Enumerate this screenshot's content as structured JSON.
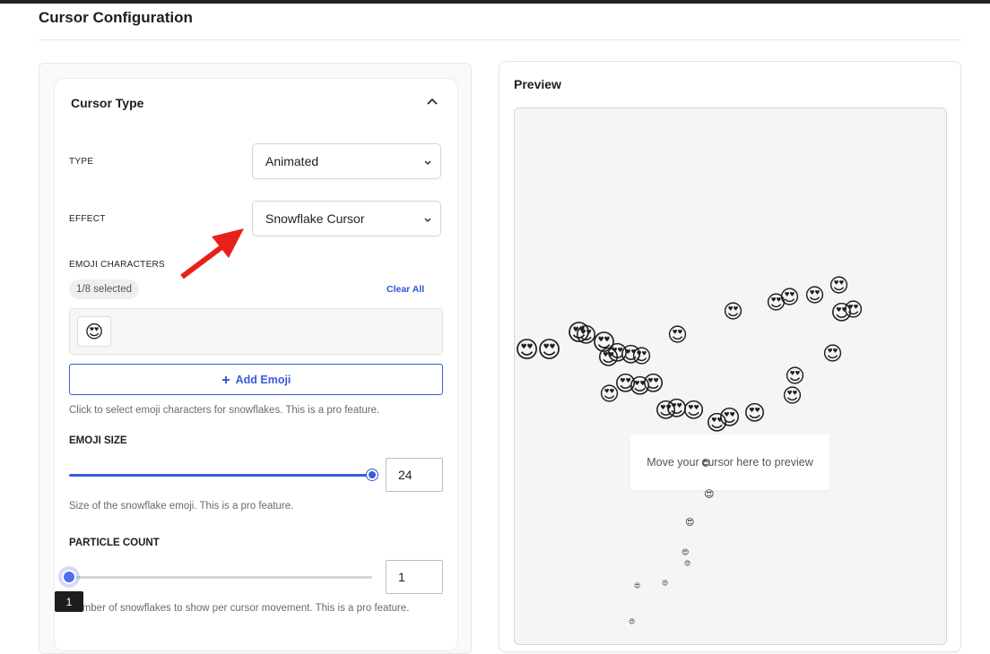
{
  "page": {
    "title": "Cursor Configuration"
  },
  "cursor_type": {
    "title": "Cursor Type",
    "type_label": "TYPE",
    "type_value": "Animated",
    "effect_label": "EFFECT",
    "effect_value": "Snowflake Cursor",
    "emoji_label": "EMOJI CHARACTERS",
    "selected_badge": "1/8 selected",
    "clear_all": "Clear All",
    "selected_emoji": "😍",
    "add_emoji_label": "Add Emoji",
    "add_emoji_help": "Click to select emoji characters for snowflakes. This is a pro feature.",
    "emoji_size_label": "EMOJI SIZE",
    "emoji_size_value": "24",
    "emoji_size_fraction": 1.0,
    "emoji_size_help": "Size of the snowflake emoji. This is a pro feature.",
    "particle_count_label": "PARTICLE COUNT",
    "particle_count_value": "1",
    "particle_count_fraction": 0.0,
    "particle_count_tooltip": "1",
    "particle_count_help": "Number of snowflakes to show per cursor movement. This is a pro feature."
  },
  "preview": {
    "title": "Preview",
    "hint": "Move your cursor here to preview",
    "particle_emoji": "😍"
  },
  "colors": {
    "accent": "#3b5bdb",
    "annotation_arrow": "#e8201c"
  },
  "icons": {
    "collapse": "chevron-up-icon",
    "select_caret": "chevron-down-icon",
    "add": "plus-icon",
    "annotation": "red-arrow-icon"
  }
}
